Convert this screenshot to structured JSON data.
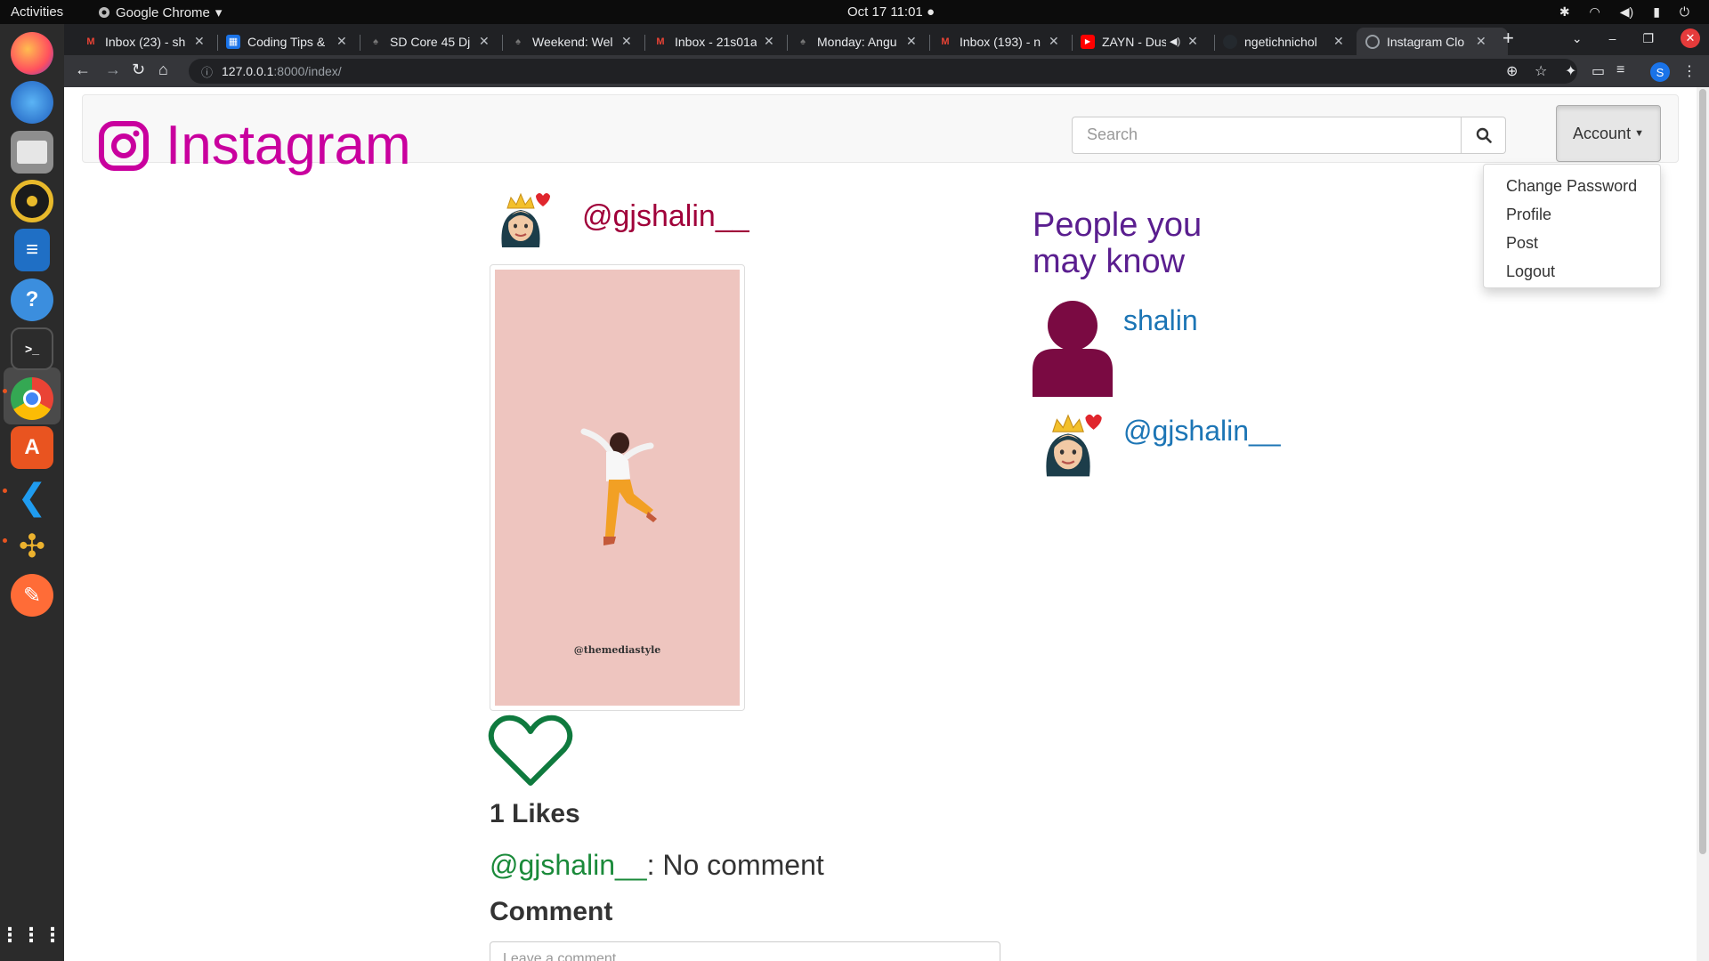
{
  "topbar": {
    "activities": "Activities",
    "app": "Google Chrome",
    "clock": "Oct 17  11:01"
  },
  "dock": [
    {
      "name": "firefox-icon",
      "color": "#ff7139"
    },
    {
      "name": "thunderbird-icon",
      "color": "#2f7cd6"
    },
    {
      "name": "files-icon",
      "color": "#8a8a8a"
    },
    {
      "name": "rhythmbox-icon",
      "color": "#e8b92b"
    },
    {
      "name": "writer-icon",
      "color": "#1f6fc5"
    },
    {
      "name": "help-icon",
      "color": "#3b8ede"
    },
    {
      "name": "terminal-icon",
      "color": "#3a3a3a"
    },
    {
      "name": "chrome-icon",
      "color": "#4285f4"
    },
    {
      "name": "software-icon",
      "color": "#e95420"
    },
    {
      "name": "vscode-icon",
      "color": "#0a7ad6"
    },
    {
      "name": "slack-icon",
      "color": "#ecb22e"
    },
    {
      "name": "postman-icon",
      "color": "#ff6c37"
    },
    {
      "name": "app-grid-icon",
      "color": "#2b2b2b"
    }
  ],
  "tabs": [
    {
      "title": "Inbox (23) - sh",
      "color": "#ea4335"
    },
    {
      "title": "Coding Tips &",
      "color": "#1a73e8"
    },
    {
      "title": "SD Core 45 Dj",
      "color": "#555555"
    },
    {
      "title": "Weekend: Wel",
      "color": "#555555"
    },
    {
      "title": "Inbox - 21s01a",
      "color": "#ea4335"
    },
    {
      "title": "Monday: Angu",
      "color": "#555555"
    },
    {
      "title": "Inbox (193) - n",
      "color": "#ea4335"
    },
    {
      "title": "ZAYN - Dus",
      "color": "#ff0000"
    },
    {
      "title": "ngetichnichol",
      "color": "#24292e"
    },
    {
      "title": "Instagram Clo",
      "color": "#9aa0a6"
    }
  ],
  "address": {
    "host": "127.0.0.1",
    "path": ":8000/index/"
  },
  "app": {
    "brand": "Instagram",
    "search_placeholder": "Search",
    "account_label": "Account",
    "account_menu": [
      "Change Password",
      "Profile",
      "Post",
      "Logout"
    ]
  },
  "post": {
    "username": "@gjshalin__",
    "image_tag": "@themediastyle",
    "likes": "1 Likes",
    "comment_user": "@gjshalin__",
    "comment_text": ": No comment",
    "comment_heading": "Comment",
    "comment_placeholder": "Leave a comment"
  },
  "suggestions": {
    "heading": "People you may know",
    "people": [
      {
        "name": "shalin"
      },
      {
        "name": "@gjshalin__"
      }
    ]
  }
}
